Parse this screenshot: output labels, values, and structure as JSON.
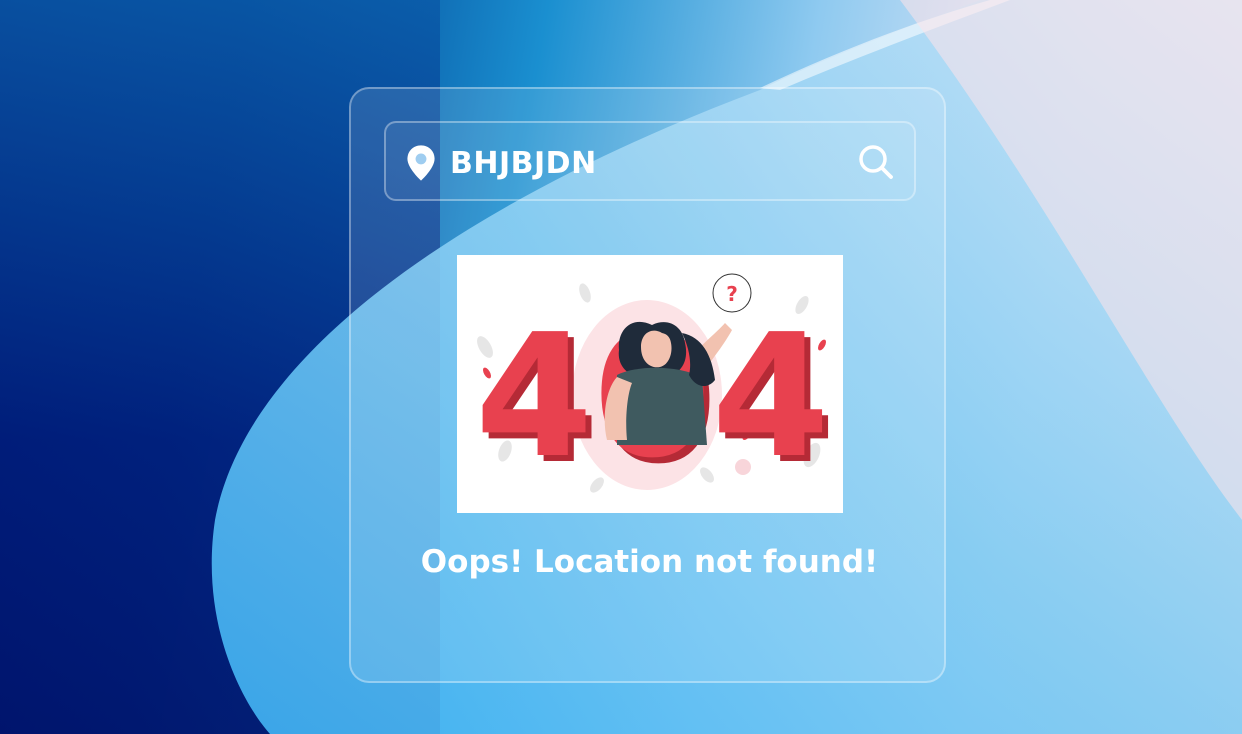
{
  "search": {
    "value": "BHJBJDN",
    "location_icon": "map-pin-icon",
    "search_icon": "search-icon"
  },
  "illustration": {
    "text": "404",
    "question_mark": "?"
  },
  "message": "Oops! Location not found!",
  "colors": {
    "accent_red": "#e8414f",
    "text": "#ffffff"
  }
}
